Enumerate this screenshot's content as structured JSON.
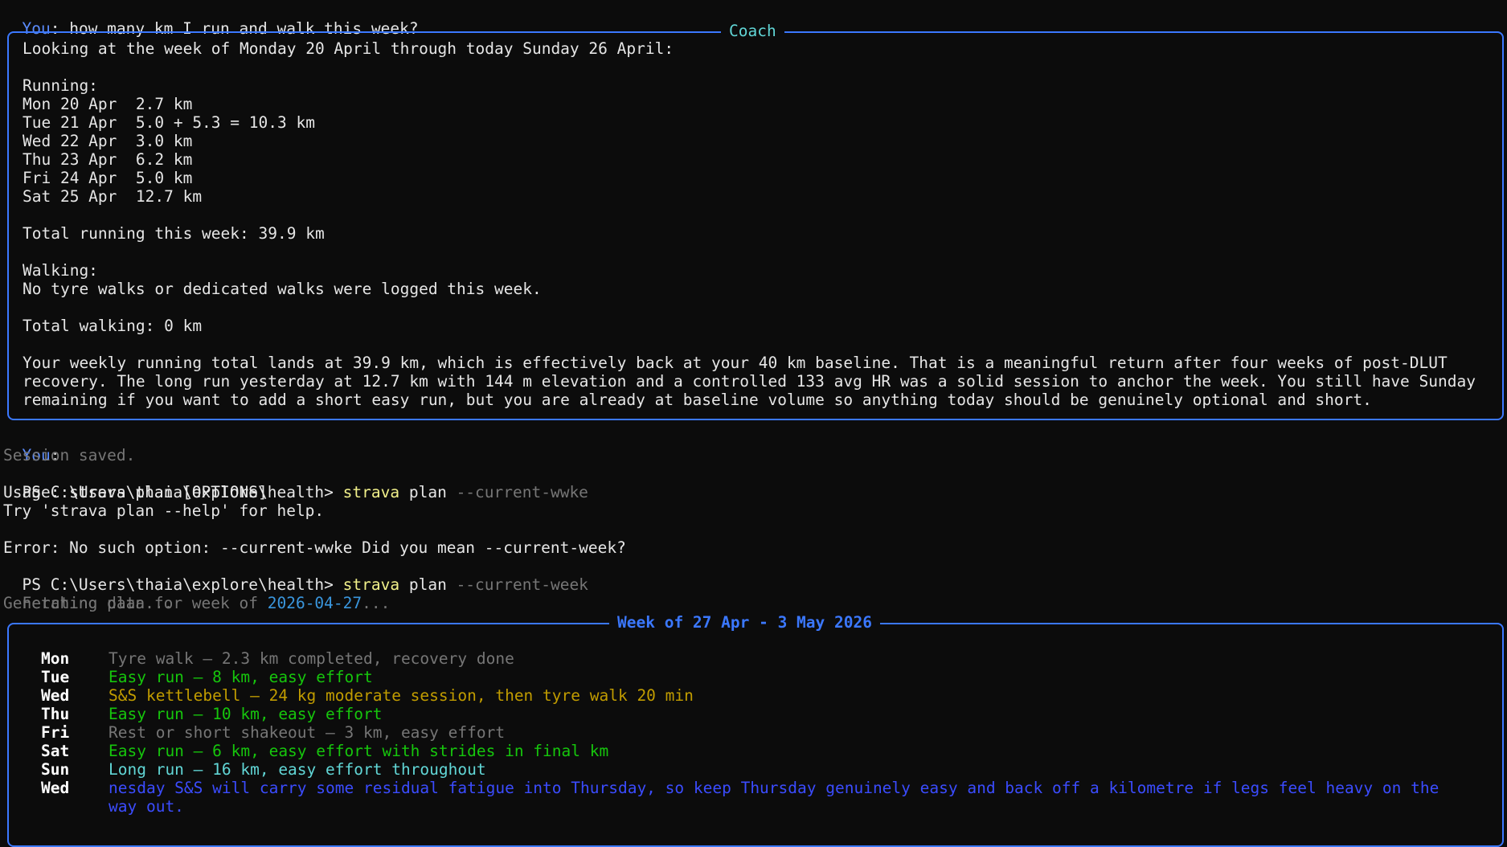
{
  "terminal": {
    "prompt_label": "You",
    "question": ": how many km I run and walk this week?",
    "coach_title": "Coach",
    "coach_lines": [
      "Looking at the week of Monday 20 April through today Sunday 26 April:",
      "",
      "Running:",
      "Mon 20 Apr  2.7 km",
      "Tue 21 Apr  5.0 + 5.3 = 10.3 km",
      "Wed 22 Apr  3.0 km",
      "Thu 23 Apr  6.2 km",
      "Fri 24 Apr  5.0 km",
      "Sat 25 Apr  12.7 km",
      "",
      "Total running this week: 39.9 km",
      "",
      "Walking:",
      "No tyre walks or dedicated walks were logged this week.",
      "",
      "Total walking: 0 km",
      ""
    ],
    "coach_paragraph": "Your weekly running total lands at 39.9 km, which is effectively back at your 40 km baseline. That is a meaningful return after four weeks of post-DLUT recovery. The long run yesterday at 12.7 km with 144 m elevation and a controlled 133 avg HR was a solid session to anchor the week. You still have Sunday remaining if you want to add a short easy run, but you are already at baseline volume so anything today should be genuinely optional and short.",
    "you_empty": ":",
    "session_saved": "Session saved.",
    "ps_prompt": "PS C:\\Users\\thaia\\explore\\health> ",
    "cmd1_name": "strava",
    "cmd1_sub": " plan ",
    "cmd1_flag": "--current-wwke",
    "usage": "Usage: strava plan [OPTIONS]",
    "try_help": "Try 'strava plan --help' for help.",
    "error": "Error: No such option: --current-wwke Did you mean --current-week?",
    "cmd2_name": "strava",
    "cmd2_sub": " plan ",
    "cmd2_flag": "--current-week",
    "fetching_prefix": "Fetching data for week of ",
    "fetching_date": "2026-04-27",
    "fetching_suffix": "...",
    "generating": "Generating plan...",
    "plan_title": "Week of 27 Apr - 3 May 2026",
    "plan": [
      {
        "day": "Mon",
        "text": "Tyre walk — 2.3 km completed, recovery done",
        "color": "#767676"
      },
      {
        "day": "Tue",
        "text": "Easy run — 8 km, easy effort",
        "color": "#16c60c"
      },
      {
        "day": "Wed",
        "text": "S&S kettlebell — 24 kg moderate session, then tyre walk 20 min",
        "color": "#c19c00"
      },
      {
        "day": "Thu",
        "text": "Easy run — 10 km, easy effort",
        "color": "#16c60c"
      },
      {
        "day": "Fri",
        "text": "Rest or short shakeout — 3 km, easy effort",
        "color": "#767676"
      },
      {
        "day": "Sat",
        "text": "Easy run — 6 km, easy effort with strides in final km",
        "color": "#16c60c"
      },
      {
        "day": "Sun",
        "text": "Long run — 16 km, easy effort throughout",
        "color": "#61d6d6"
      }
    ],
    "plan_note_day": "Wed",
    "plan_note": "nesday S&S will carry some residual fatigue into Thursday, so keep Thursday genuinely easy and back off a kilometre if legs feel heavy on the way out."
  }
}
